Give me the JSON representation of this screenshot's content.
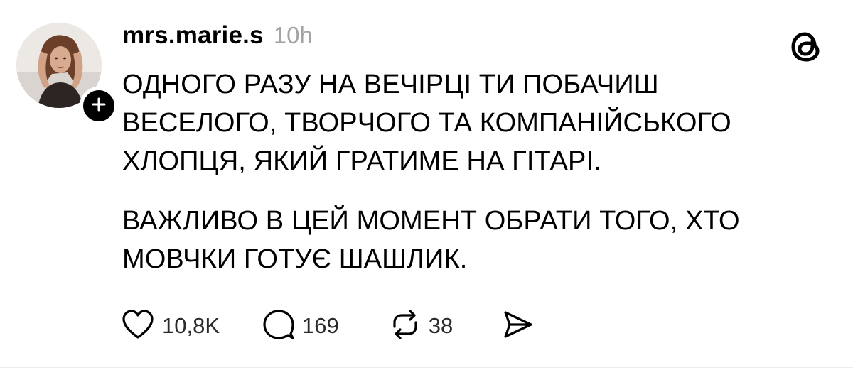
{
  "post": {
    "username": "mrs.marie.s",
    "timestamp": "10h",
    "paragraphs": [
      "ОДНОГО РАЗУ НА ВЕЧІРЦІ ТИ ПОБАЧИШ\nВЕСЕЛОГО, ТВОРЧОГО ТА КОМПАНІЙСЬКОГО\nХЛОПЦЯ, ЯКИЙ ГРАТИМЕ НА ГІТАРІ.",
      "ВАЖЛИВО В ЦЕЙ МОМЕНТ ОБРАТИ ТОГО, ХТО\nМОВЧКИ ГОТУЄ ШАШЛИК."
    ]
  },
  "actions": {
    "likes": "10,8K",
    "replies": "169",
    "reposts": "38"
  },
  "icons": {
    "like": "heart-icon",
    "reply": "speech-bubble-icon",
    "repost": "repost-icon",
    "share": "send-icon",
    "follow": "plus-icon",
    "brand": "threads-logo-icon"
  },
  "colors": {
    "text": "#000000",
    "muted": "#a3a3a3",
    "background": "#ffffff"
  }
}
